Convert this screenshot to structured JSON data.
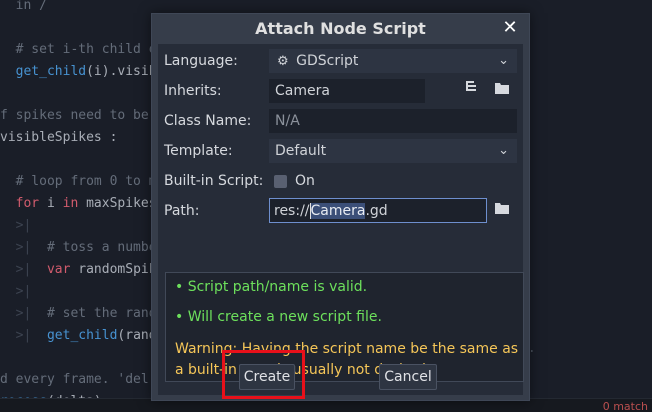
{
  "editor": {
    "lines": [
      {
        "tokens": [
          {
            "cls": "c",
            "text": "  in /"
          }
        ]
      },
      {
        "tokens": []
      },
      {
        "tokens": [
          {
            "cls": "c",
            "text": "  # set i-th child o"
          }
        ]
      },
      {
        "tokens": [
          {
            "cls": "f",
            "text": "  get_child"
          },
          {
            "cls": "t",
            "text": "(i).visib"
          }
        ]
      },
      {
        "tokens": []
      },
      {
        "tokens": [
          {
            "cls": "c",
            "text": "f spikes need to be"
          }
        ]
      },
      {
        "tokens": [
          {
            "cls": "t",
            "text": "visibleSpikes :"
          }
        ]
      },
      {
        "tokens": []
      },
      {
        "tokens": [
          {
            "cls": "c",
            "text": "  # loop from 0 to ma"
          }
        ]
      },
      {
        "tokens": [
          {
            "cls": "k",
            "text": "  for"
          },
          {
            "cls": "t",
            "text": " i "
          },
          {
            "cls": "k",
            "text": "in"
          },
          {
            "cls": "t",
            "text": " maxSpikes"
          }
        ]
      },
      {
        "tokens": [
          {
            "cls": "tab",
            "text": "  >|"
          }
        ]
      },
      {
        "tokens": [
          {
            "cls": "tab",
            "text": "  >|  "
          },
          {
            "cls": "c",
            "text": "# toss a numbe"
          }
        ]
      },
      {
        "tokens": [
          {
            "cls": "tab",
            "text": "  >|  "
          },
          {
            "cls": "k",
            "text": "var"
          },
          {
            "cls": "t",
            "text": " randomSpik"
          }
        ]
      },
      {
        "tokens": [
          {
            "cls": "tab",
            "text": "  >|"
          }
        ]
      },
      {
        "tokens": [
          {
            "cls": "tab",
            "text": "  >|  "
          },
          {
            "cls": "c",
            "text": "# set the rand"
          }
        ]
      },
      {
        "tokens": [
          {
            "cls": "tab",
            "text": "  >|  "
          },
          {
            "cls": "f",
            "text": "get_child"
          },
          {
            "cls": "t",
            "text": "(rand"
          }
        ]
      },
      {
        "tokens": []
      },
      {
        "tokens": [
          {
            "cls": "c",
            "text": "d every frame. 'del"
          }
        ]
      },
      {
        "tokens": [
          {
            "cls": "f",
            "text": "rocess"
          },
          {
            "cls": "t",
            "text": "(delta) :"
          }
        ]
      }
    ],
    "right_text": "e.",
    "bottom_right": "0 match"
  },
  "dialog": {
    "title": "Attach Node Script",
    "close_icon": "close-icon",
    "language": {
      "label": "Language:",
      "value": "GDScript",
      "icon": "gear-icon"
    },
    "inherits": {
      "label": "Inherits:",
      "value": "Camera"
    },
    "class_name": {
      "label": "Class Name:",
      "value": "N/A"
    },
    "template": {
      "label": "Template:",
      "value": "Default"
    },
    "builtin": {
      "label": "Built-in Script:",
      "checkbox_label": "On",
      "checked": false
    },
    "path": {
      "label": "Path:",
      "prefix": "res://",
      "selected": "Camera",
      "suffix": ".gd"
    },
    "status": {
      "valid": "• Script path/name is valid.",
      "create": "• Will create a new script file.",
      "warning": "Warning: Having the script name be the same as a built-in type is usually not desired."
    },
    "create_label": "Create",
    "cancel_label": "Cancel"
  },
  "colors": {
    "ok": "#6de05c",
    "warning": "#f5c658",
    "highlight": "#e8101a"
  }
}
